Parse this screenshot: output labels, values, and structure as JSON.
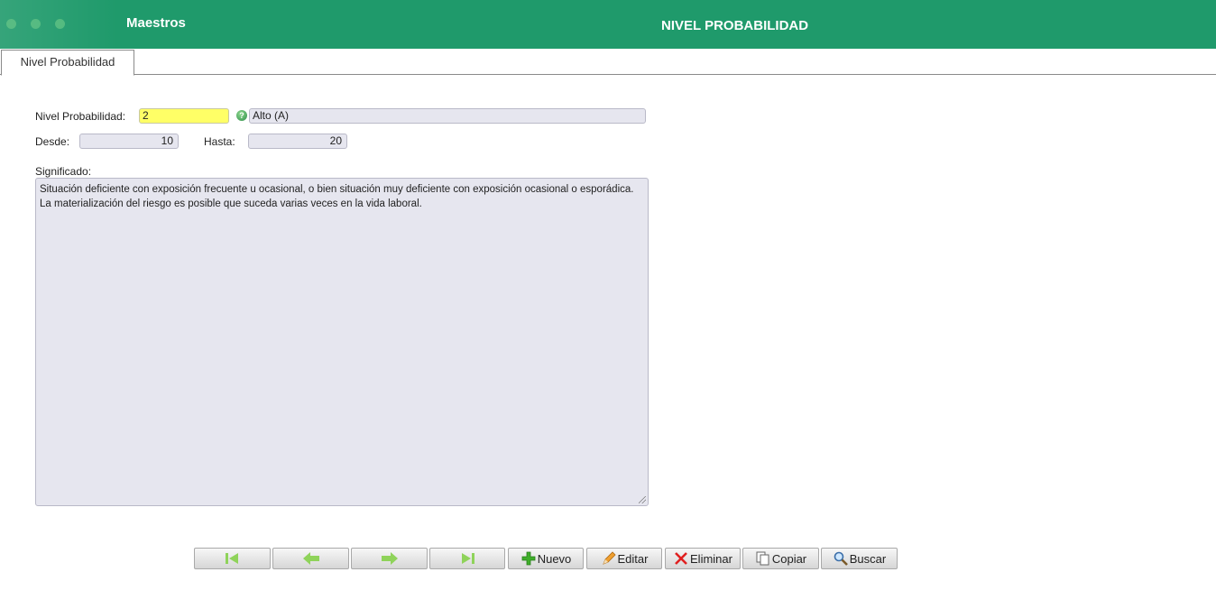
{
  "header": {
    "app_title": "Maestros",
    "page_title": "NIVEL PROBABILIDAD"
  },
  "tabs": [
    {
      "label": "Nivel Probabilidad"
    }
  ],
  "form": {
    "nivel_label": "Nivel Probabilidad:",
    "nivel_value": "2",
    "nivel_desc": "Alto (A)",
    "desde_label": "Desde:",
    "desde_value": "10",
    "hasta_label": "Hasta:",
    "hasta_value": "20",
    "significado_label": "Significado:",
    "significado_line1": "Situación deficiente con exposición frecuente u ocasional, o bien situación muy deficiente con exposición ocasional o esporádica.",
    "significado_line2": "La materialización del riesgo es posible que suceda varias veces en la vida laboral."
  },
  "toolbar": {
    "nuevo": "Nuevo",
    "editar": "Editar",
    "eliminar": "Eliminar",
    "copiar": "Copiar",
    "buscar": "Buscar"
  },
  "icons": {
    "first": "first-record-icon",
    "prev": "previous-record-icon",
    "next": "next-record-icon",
    "last": "last-record-icon",
    "help": "help-icon",
    "add": "plus-icon",
    "edit": "pencil-icon",
    "delete": "x-icon",
    "copy": "copy-icon",
    "search": "magnifier-icon"
  },
  "colors": {
    "header": "#1f9a6b",
    "required_field": "#ffff66",
    "field_bg": "#e6e6ef"
  }
}
